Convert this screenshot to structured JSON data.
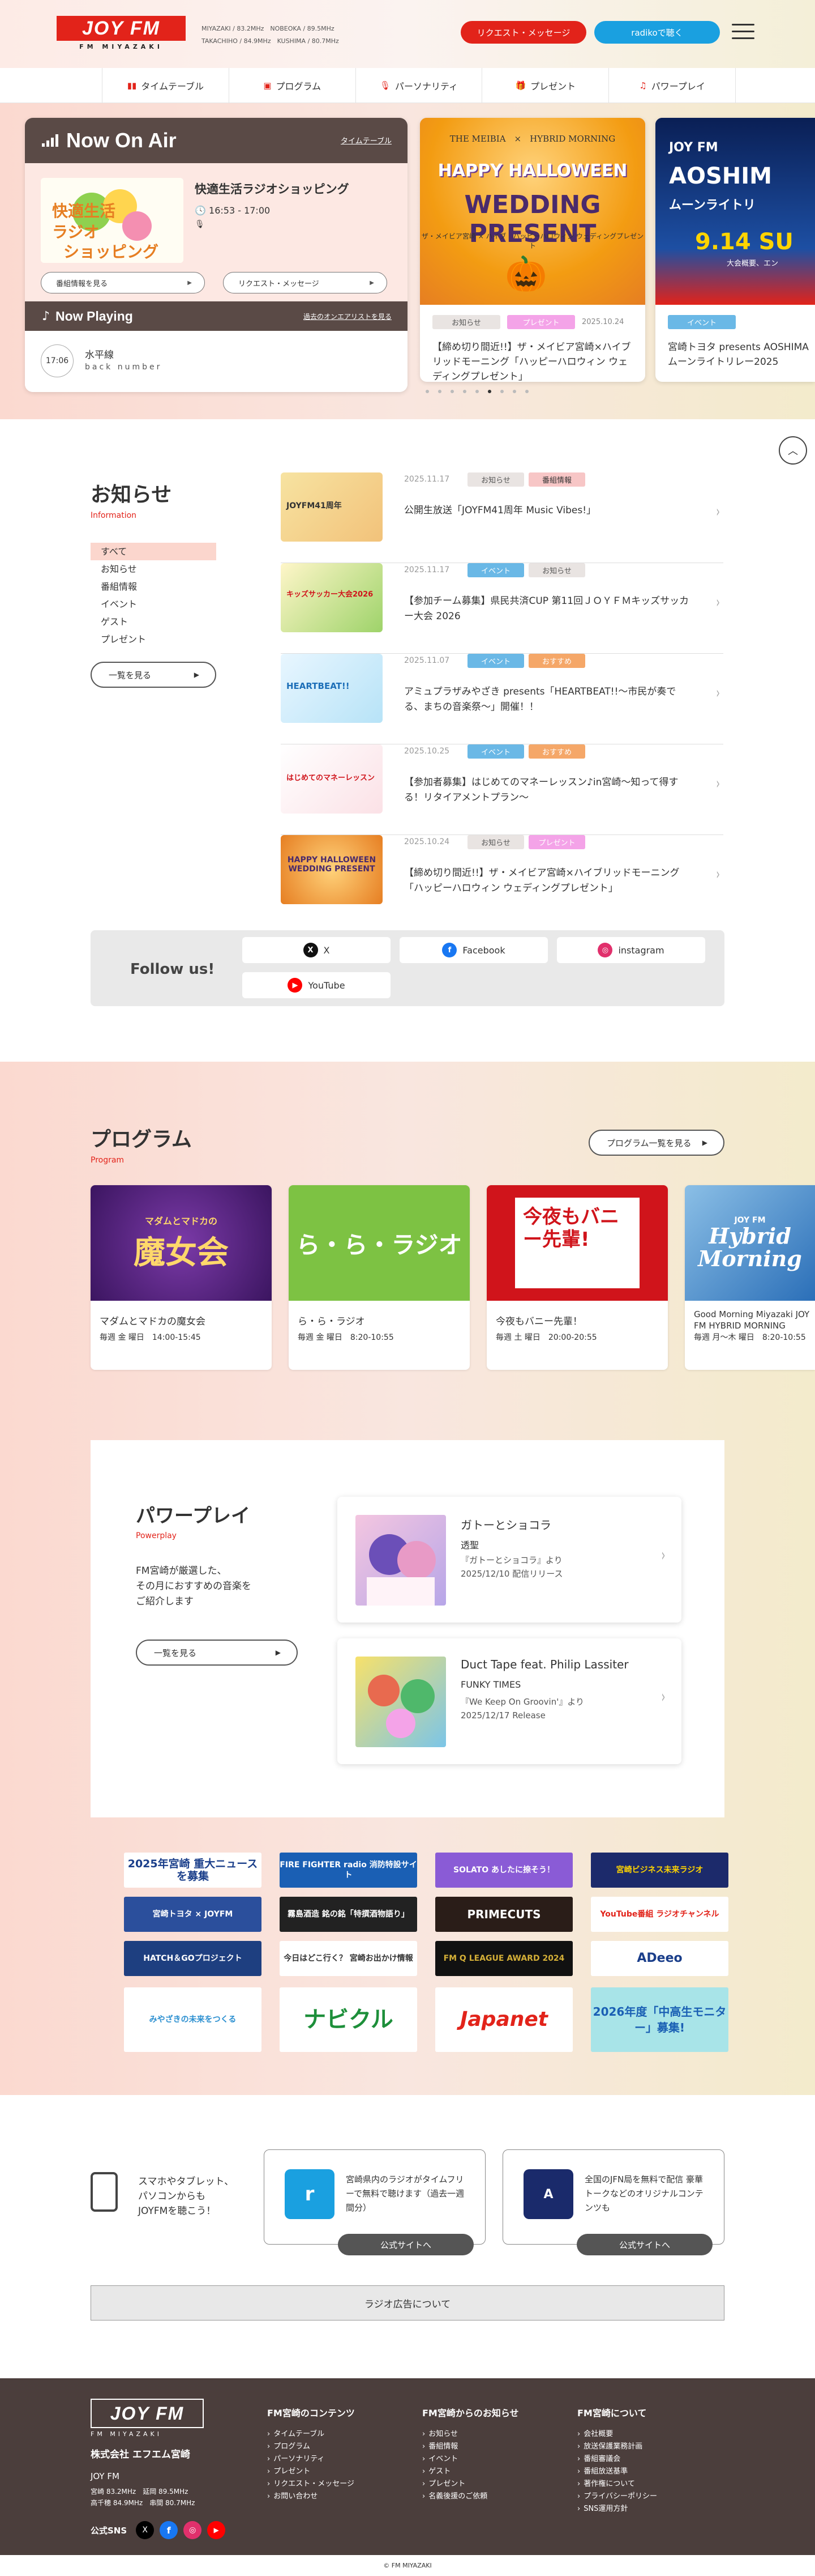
{
  "header": {
    "logo_main": "JOY FM",
    "logo_sub": "FM MIYAZAKI",
    "freq_line1": "MIYAZAKI / 83.2MHz　NOBEOKA / 89.5MHz",
    "freq_line2": "TAKACHIHO / 84.9MHz　KUSHIMA / 80.7MHz",
    "request_label": "リクエスト・メッセージ",
    "radiko_label": "radikoで聴く"
  },
  "nav": {
    "items": [
      {
        "label": "タイムテーブル",
        "icon": "bars-icon"
      },
      {
        "label": "プログラム",
        "icon": "radio-icon"
      },
      {
        "label": "パーソナリティ",
        "icon": "mic-icon"
      },
      {
        "label": "プレゼント",
        "icon": "gift-icon"
      },
      {
        "label": "パワープレイ",
        "icon": "music-icon"
      }
    ]
  },
  "onair": {
    "title": "Now On Air",
    "timetable_link": "タイムテーブル",
    "program_name": "快適生活ラジオショッピング",
    "program_time": "16:53 - 17:00",
    "program_logo_text": "快適生活ラジオショッピング",
    "program_info_btn": "番組情報を見る",
    "request_btn": "リクエスト・メッセージ",
    "np_title": "Now Playing",
    "np_link": "過去のオンエアリストを見る",
    "np_time": "17:06",
    "np_song": "水平線",
    "np_artist": "back number"
  },
  "slides": [
    {
      "tags": [
        "お知らせ",
        "プレゼント"
      ],
      "date": "2025.10.24",
      "caption": "【締め切り間近!!】ザ・メイビア宮崎×ハイブリッドモーニング「ハッピーハロウィン ウェディングプレゼント」",
      "img_top": "THE MEIBIA　×　HYBRID MORNING",
      "img_main1": "HAPPY HALLOWEEN",
      "img_main2": "WEDDING PRESENT",
      "img_bottom": "ザ・メイビア宮崎 × ハイブ　ハッピーハロウィン ウェディングプレゼント"
    },
    {
      "tags": [
        "イベント"
      ],
      "date": "",
      "caption": "宮崎トヨタ presents AOSHIMA ムーンライトリレー2025",
      "img_top": "JOY FM",
      "img_main1": "AOSHIM",
      "img_main2": "ムーンライトリ",
      "img_bottom": "9.14 SU",
      "img_extra": "大会概要、エン"
    }
  ],
  "news": {
    "title": "お知らせ",
    "subtitle": "Information",
    "categories": [
      "すべて",
      "お知らせ",
      "番組情報",
      "イベント",
      "ゲスト",
      "プレゼント"
    ],
    "more_label": "一覧を見る",
    "items": [
      {
        "date": "2025.11.17",
        "tags": [
          "お知らせ",
          "番組情報"
        ],
        "title": "公開生放送「JOYFM41周年 Music Vibes!」"
      },
      {
        "date": "2025.11.17",
        "tags": [
          "イベント",
          "お知らせ"
        ],
        "title": "【参加チーム募集】県民共済CUP 第11回ＪＯＹＦＭキッズサッカー大会 2026"
      },
      {
        "date": "2025.11.07",
        "tags": [
          "イベント",
          "おすすめ"
        ],
        "title": "アミュプラザみやざき presents「HEARTBEAT!!〜市民が奏でる、まちの音楽祭〜」開催！！"
      },
      {
        "date": "2025.10.25",
        "tags": [
          "イベント",
          "おすすめ"
        ],
        "title": "【参加者募集】はじめてのマネーレッスン♪in宮崎〜知って得する！リタイアメントプラン〜"
      },
      {
        "date": "2025.10.24",
        "tags": [
          "お知らせ",
          "プレゼント"
        ],
        "title": "【締め切り間近!!】ザ・メイビア宮崎×ハイブリッドモーニング「ハッピーハロウィン ウェディングプレゼント」"
      }
    ],
    "thumbs": [
      "JOYFM41周年",
      "キッズサッカー大会2026",
      "HEARTBEAT!!",
      "はじめてのマネーレッスン",
      "HAPPY HALLOWEEN WEDDING PRESENT"
    ],
    "follow_label": "Follow us!",
    "sns": [
      {
        "name": "X",
        "icon": "x-icon",
        "color": "#111111",
        "glyph": "X"
      },
      {
        "name": "Facebook",
        "icon": "facebook-icon",
        "color": "#1877f2",
        "glyph": "f"
      },
      {
        "name": "instagram",
        "icon": "instagram-icon",
        "color": "#e1306c",
        "glyph": "◎"
      },
      {
        "name": "YouTube",
        "icon": "youtube-icon",
        "color": "#ff0000",
        "glyph": "▶"
      }
    ]
  },
  "program": {
    "title": "プログラム",
    "subtitle": "Program",
    "list_label": "プログラム一覧を見る",
    "cards": [
      {
        "name": "マダムとマドカの魔女会",
        "time": "毎週 金 曜日　14:00-15:45",
        "img": "魔女会",
        "img_sub": "マダムとマドカの",
        "color": "#5b2c83"
      },
      {
        "name": "ら・ら・ラジオ",
        "time": "毎週 金 曜日　8:20-10:55",
        "img": "ら・ら・ラジオ",
        "img_sub": "",
        "color": "#7dc243"
      },
      {
        "name": "今夜もバニー先輩！",
        "time": "毎週 土 曜日　20:00-20:55",
        "img": "今夜もバニー先輩!",
        "img_sub": "",
        "color": "#d0141b"
      },
      {
        "name": "Good Morning Miyazaki JOY FM HYBRID MORNING",
        "time": "毎週 月〜木 曜日　8:20-10:55",
        "img": "Hybrid Morning",
        "img_sub": "JOY FM",
        "color": "#3d8fd0"
      }
    ]
  },
  "powerplay": {
    "title": "パワープレイ",
    "subtitle": "Powerplay",
    "desc1": "FM宮崎が厳選した、",
    "desc2": "その月におすすめの音楽を",
    "desc3": "ご紹介します",
    "more_label": "一覧を見る",
    "items": [
      {
        "song": "ガトーとショコラ",
        "artist": "透聖",
        "desc1": "『ガトーとショコラ』より",
        "desc2": "2025/12/10 配信リリース"
      },
      {
        "song": "Duct Tape feat. Philip Lassiter",
        "artist": "FUNKY TIMES",
        "desc1": "『We Keep On Groovin'』より",
        "desc2": "2025/12/17 Release"
      }
    ]
  },
  "banners": [
    {
      "text": "2025年宮崎\n重大ニュースを募集",
      "bg": "#ffffff",
      "fg": "#1a3e8a"
    },
    {
      "text": "FIRE FIGHTER radio 消防特設サイト",
      "bg": "#1a5fb4",
      "fg": "#ffffff"
    },
    {
      "text": "SOLATO あしたに捺そう！",
      "bg": "#8a5bd6",
      "fg": "#ffffff"
    },
    {
      "text": "宮崎ビジネス未来ラジオ",
      "bg": "#1c2a6b",
      "fg": "#ffd400"
    },
    {
      "text": "宮崎トヨタ × JOYFM",
      "bg": "#2b4f9c",
      "fg": "#ffffff"
    },
    {
      "text": "霧島酒造 銘の銘「特撰酒物語り」",
      "bg": "#222222",
      "fg": "#ffffff"
    },
    {
      "text": "PRIMECUTS",
      "bg": "#2a1d18",
      "fg": "#ffffff"
    },
    {
      "text": "YouTube番組 ラジオチャンネル",
      "bg": "#ffffff",
      "fg": "#e2231a"
    },
    {
      "text": "HATCH＆GOプロジェクト",
      "bg": "#1e3f80",
      "fg": "#ffffff"
    },
    {
      "text": "今日はどこ行く？ 宮崎お出かけ情報",
      "bg": "#ffffff",
      "fg": "#333333"
    },
    {
      "text": "FM Q LEAGUE AWARD 2024",
      "bg": "#111111",
      "fg": "#d4af37"
    },
    {
      "text": "ADeeo",
      "bg": "#ffffff",
      "fg": "#1a3e8a"
    },
    {
      "text": "みやざきの未来をつくる",
      "bg": "#ffffff",
      "fg": "#2b8fd0"
    },
    {
      "text": "ナビクル",
      "bg": "#ffffff",
      "fg": "#1d8f3a"
    },
    {
      "text": "Japanet",
      "bg": "#ffffff",
      "fg": "#e2231a"
    },
    {
      "text": "2026年度「中高生モニター」募集!",
      "bg": "#a8e4e8",
      "fg": "#1a5fb4"
    }
  ],
  "apps": {
    "intro1": "スマホやタブレット、",
    "intro2": "パソコンからも",
    "intro3": "JOYFMを聴こう！",
    "radiko_text": "宮崎県内のラジオがタイムフリーで無料で聴けます（過去一週間分）",
    "adeeo_text": "全国のJFN局を無料で配信 豪華トークなどのオリジナルコンテンツも",
    "btn_label": "公式サイトへ",
    "ad_label": "ラジオ広告について"
  },
  "footer": {
    "logo": "JOY FM",
    "logo_sub": "FM MIYAZAKI",
    "company": "株式会社 エフエム宮崎",
    "station": "JOY FM",
    "f1": "宮崎 83.2MHz　延岡 89.5MHz",
    "f2": "高千穂 84.9MHz　串間 80.7MHz",
    "sns_label": "公式SNS",
    "col1_title": "FM宮崎のコンテンツ",
    "col1": [
      "タイムテーブル",
      "プログラム",
      "パーソナリティ",
      "プレゼント",
      "リクエスト・メッセージ",
      "お問い合わせ"
    ],
    "col2_title": "FM宮崎からのお知らせ",
    "col2": [
      "お知らせ",
      "番組情報",
      "イベント",
      "ゲスト",
      "プレゼント",
      "名義後援のご依頼"
    ],
    "col3_title": "FM宮崎について",
    "col3": [
      "会社概要",
      "放送保護業務計画",
      "番組審議会",
      "番組放送基準",
      "著作権について",
      "プライバシーポリシー",
      "SNS運用方針"
    ],
    "copyright": "© FM MIYAZAKI"
  }
}
